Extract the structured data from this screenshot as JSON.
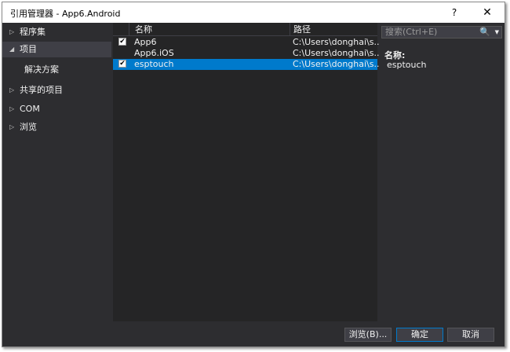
{
  "window": {
    "title": "引用管理器 - App6.Android",
    "help_label": "?",
    "close_label": "✕"
  },
  "sidebar": {
    "items": [
      {
        "label": "程序集",
        "arrow": "▷"
      },
      {
        "label": "项目",
        "arrow": "◢"
      },
      {
        "label": "解决方案",
        "arrow": ""
      },
      {
        "label": "共享的项目",
        "arrow": "▷"
      },
      {
        "label": "COM",
        "arrow": "▷"
      },
      {
        "label": "浏览",
        "arrow": "▷"
      }
    ]
  },
  "table": {
    "columns": [
      "名称",
      "路径"
    ],
    "rows": [
      {
        "checked": "✔",
        "name": "App6",
        "path": "C:\\Users\\donghai\\s..."
      },
      {
        "checked": "",
        "name": "App6.iOS",
        "path": "C:\\Users\\donghai\\s..."
      },
      {
        "checked": "✔",
        "name": "esptouch",
        "path": "C:\\Users\\donghai\\s..."
      }
    ]
  },
  "search": {
    "placeholder": "搜索(Ctrl+E)",
    "icon": "🔍",
    "dropdown": "▼"
  },
  "details": {
    "name_label": "名称:",
    "name_value": "esptouch"
  },
  "footer": {
    "browse_label": "浏览(B)...",
    "ok_label": "确定",
    "cancel_label": "取消"
  }
}
